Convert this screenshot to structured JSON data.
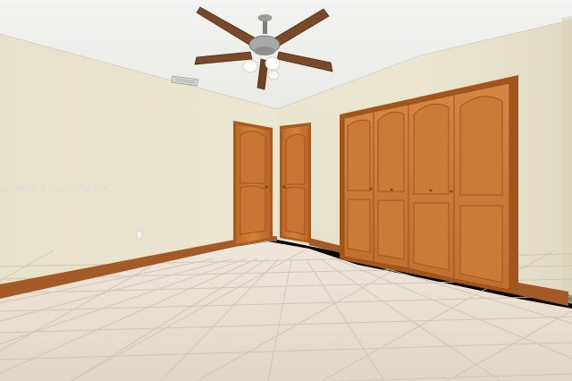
{
  "watermark": {
    "text": "A11706182 © Miami MLS® 2024"
  },
  "palette": {
    "ceiling": "#efefec",
    "left_wall": "#e4dfc8",
    "back_wall": "#e9e4ce",
    "right_wall": "#e2ddc6",
    "wood": "#c8742c",
    "wood_dark": "#9a5118",
    "tile": "#e7dccd",
    "grout": "#cdbfae",
    "baseboard": "#a55a25"
  },
  "icons": {
    "fan": "ceiling-fan-icon",
    "vent": "air-vent-icon"
  }
}
